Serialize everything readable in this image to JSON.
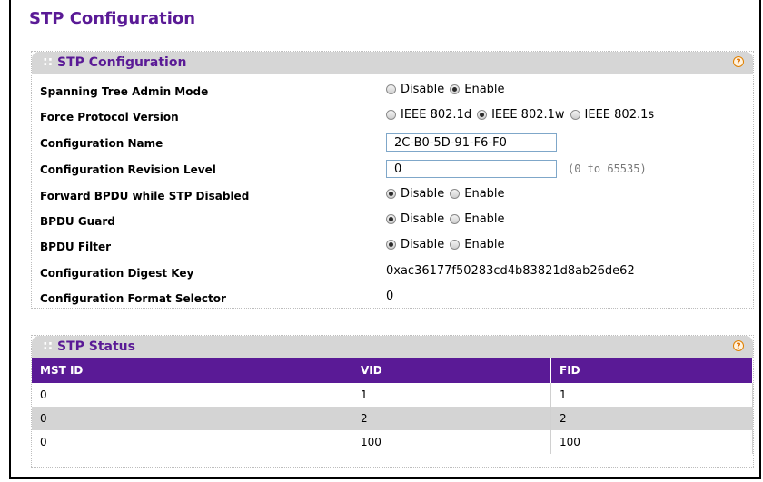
{
  "page": {
    "title": "STP Configuration"
  },
  "config_panel": {
    "title": "STP Configuration",
    "grip": "::",
    "help": "?",
    "fields": {
      "admin_mode": {
        "label": "Spanning Tree Admin Mode",
        "options": [
          "Disable",
          "Enable"
        ],
        "selected": "Enable"
      },
      "force_protocol": {
        "label": "Force Protocol Version",
        "options": [
          "IEEE 802.1d",
          "IEEE 802.1w",
          "IEEE 802.1s"
        ],
        "selected": "IEEE 802.1w"
      },
      "config_name": {
        "label": "Configuration Name",
        "value": "2C-B0-5D-91-F6-F0"
      },
      "revision_level": {
        "label": "Configuration Revision Level",
        "value": "0",
        "range": "(0 to 65535)"
      },
      "forward_bpdu": {
        "label": "Forward BPDU while STP Disabled",
        "options": [
          "Disable",
          "Enable"
        ],
        "selected": "Disable"
      },
      "bpdu_guard": {
        "label": "BPDU Guard",
        "options": [
          "Disable",
          "Enable"
        ],
        "selected": "Disable"
      },
      "bpdu_filter": {
        "label": "BPDU Filter",
        "options": [
          "Disable",
          "Enable"
        ],
        "selected": "Disable"
      },
      "digest_key": {
        "label": "Configuration Digest Key",
        "value": "0xac36177f50283cd4b83821d8ab26de62"
      },
      "format_selector": {
        "label": "Configuration Format Selector",
        "value": "0"
      }
    }
  },
  "status_panel": {
    "title": "STP Status",
    "grip": "::",
    "help": "?",
    "columns": [
      "MST ID",
      "VID",
      "FID"
    ],
    "rows": [
      [
        "0",
        "1",
        "1"
      ],
      [
        "0",
        "2",
        "2"
      ],
      [
        "0",
        "100",
        "100"
      ]
    ]
  }
}
